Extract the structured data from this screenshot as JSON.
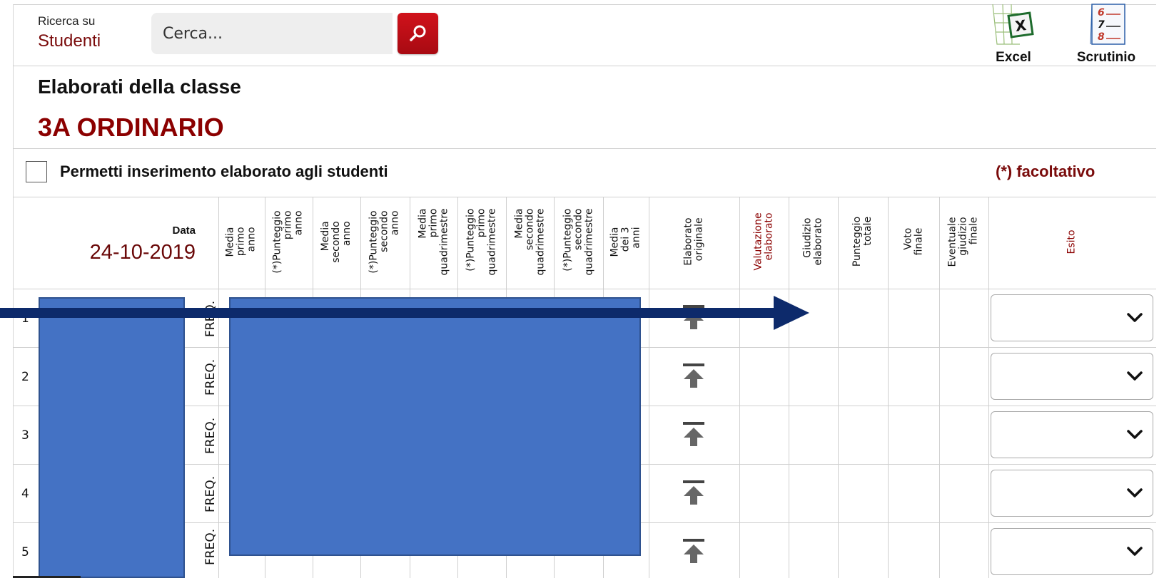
{
  "header": {
    "search_label_small": "Ricerca su",
    "search_label_big": "Studenti",
    "search_placeholder": "Cerca...",
    "excel_label": "Excel",
    "scrutinio_label": "Scrutinio"
  },
  "page": {
    "title": "Elaborati della classe",
    "class_name": "3A ORDINARIO",
    "permit_label": "Permetti inserimento elaborato agli studenti",
    "facoltativo_note": "(*) facoltativo"
  },
  "table": {
    "date_label": "Data",
    "date_value": "24-10-2019",
    "columns": [
      "Media\nprimo\nanno",
      "(*)Punteggio\nprimo\nanno",
      "Media\nsecondo\nanno",
      "(*)Punteggio\nsecondo\nanno",
      "Media\nprimo\nquadrimestre",
      "(*)Punteggio\nprimo\nquadrimestre",
      "Media\nsecondo\nquadrimestre",
      "(*)Punteggio\nsecondo\nquadrimestre",
      "Media\ndei 3\nanni",
      "Elaborato\noriginale",
      "Valutazione\nelaborato",
      "Giudizio\nelaborato",
      "Punteggio\ntotale",
      "Voto\nfinale",
      "Eventuale\ngiudizio\nfinale",
      "Esito"
    ],
    "rows": [
      {
        "num": "1",
        "status": "FREQ."
      },
      {
        "num": "2",
        "status": "FREQ."
      },
      {
        "num": "3",
        "status": "FREQ."
      },
      {
        "num": "4",
        "status": "FREQ."
      },
      {
        "num": "5",
        "status": "FREQ."
      }
    ]
  },
  "colors": {
    "accent_red": "#8b0000",
    "search_button": "#c0101a",
    "mask_blue": "#4472c4",
    "arrow_navy": "#0d2a6b"
  }
}
